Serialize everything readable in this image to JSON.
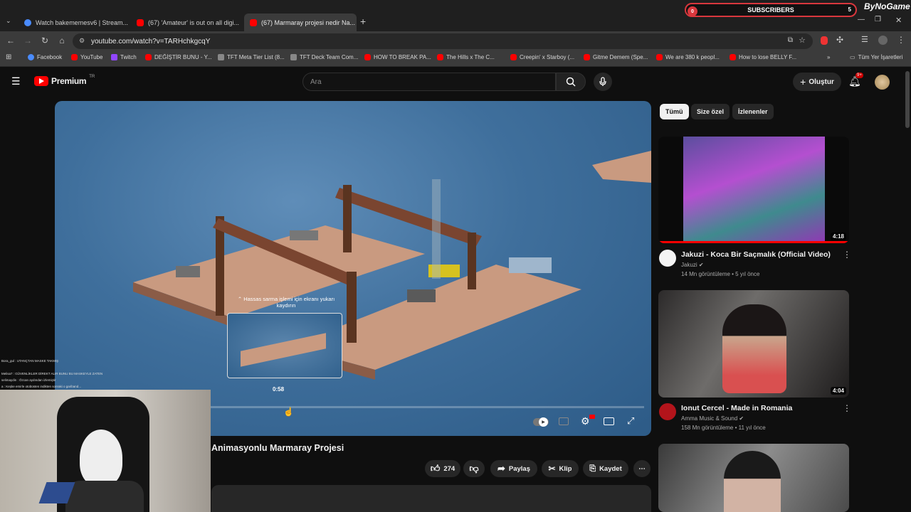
{
  "browser": {
    "tabs": [
      {
        "title": "Watch bakememesv6 | Stream...",
        "favicon": "stream-icon"
      },
      {
        "title": "(67) 'Amateur' is out on all digi...",
        "favicon": "youtube-icon"
      },
      {
        "title": "(67) Marmaray projesi nedir Na...",
        "favicon": "youtube-icon"
      }
    ],
    "url": "youtube.com/watch?v=TARHchkgcqY",
    "bookmarks": [
      "Facebook",
      "YouTube",
      "Twitch",
      "DEĞİŞTİR BUNU - Y...",
      "TFT Meta Tier List (8...",
      "TFT Deck Team Com...",
      "HOW TO BREAK PA...",
      "The Hills x The C...",
      "Creepin' x Starboy (...",
      "Gitme Demem (Spe...",
      "We are 380 k peopl...",
      "How to lose BELLY F..."
    ],
    "all_bookmarks": "Tüm Yer İşaretleri",
    "more": "»"
  },
  "overlay": {
    "subscribers_label": "SUBSCRIBERS",
    "subscribers_left": "0",
    "subscribers_right": "5",
    "brand": "ByNoGame"
  },
  "youtube": {
    "logo_text": "Premium",
    "logo_sup": "TR",
    "search_placeholder": "Ara",
    "create_label": "Oluştur",
    "notif_count": "9+"
  },
  "player": {
    "seek_hint": "Hassas sarma işlemi için ekranı yukarı kaydırın",
    "preview_time": "0:58",
    "progress_fraction": 0.16,
    "buffered_fraction": 0.202
  },
  "video": {
    "title": "Animasyonlu Marmaray Projesi",
    "likes": "274",
    "share_label": "Paylaş",
    "clip_label": "Klip",
    "save_label": "Kaydet"
  },
  "chips": [
    "Tümü",
    "Size özel",
    "İzlenenler"
  ],
  "recommendations": [
    {
      "title": "Jakuzi - Koca Bir Saçmalık (Official Video)",
      "channel": "Jakuzi",
      "meta": "14 Mn görüntüleme • 5 yıl önce",
      "duration": "4:18"
    },
    {
      "title": "Ionut Cercel - Made in Romania",
      "channel": "Amma Music & Sound",
      "meta": "158 Mn görüntüleme • 11 yıl önce",
      "duration": "4:04"
    }
  ],
  "chat": [
    "Bora_gul : UTANÇTAN MASKE TAKMIŞ",
    "Melisa7 : GÜVENLİKLER DİREKT ALIR BUNU BU MASKEYLE ZATEN",
    "selimaydin : Özcan aydından izlemiştir",
    "a : Keşke emirle otobüsten indikten sonraki o gariband..."
  ]
}
